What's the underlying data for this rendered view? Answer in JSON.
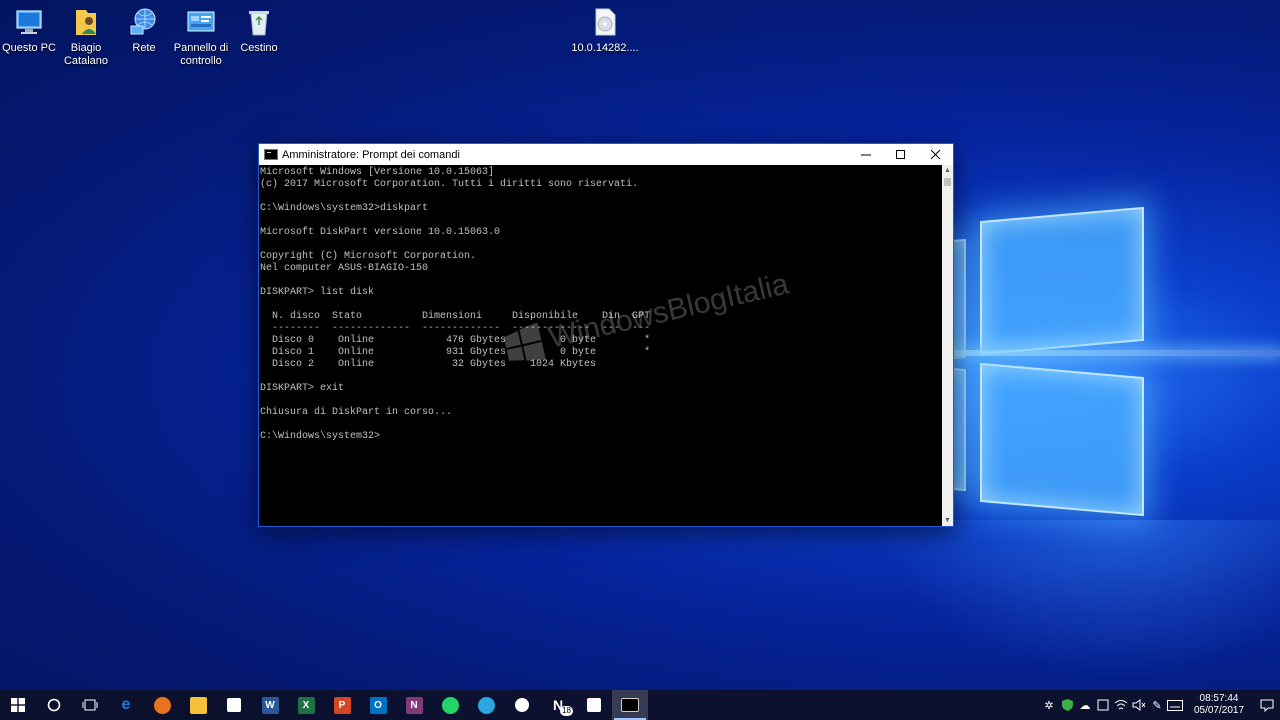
{
  "desktop": {
    "icons": [
      {
        "label": "Questo PC",
        "icon": "computer-icon"
      },
      {
        "label": "Biagio Catalano",
        "icon": "user-folder-icon"
      },
      {
        "label": "Rete",
        "icon": "network-icon"
      },
      {
        "label": "Pannello di controllo",
        "icon": "control-panel-icon"
      },
      {
        "label": "Cestino",
        "icon": "recycle-bin-icon"
      },
      {
        "label": "10.0.14282....",
        "icon": "disc-image-icon"
      }
    ]
  },
  "cmd_window": {
    "title": "Amministratore: Prompt dei comandi",
    "console_lines": [
      "Microsoft Windows [Versione 10.0.15063]",
      "(c) 2017 Microsoft Corporation. Tutti i diritti sono riservati.",
      "",
      "C:\\Windows\\system32>diskpart",
      "",
      "Microsoft DiskPart versione 10.0.15063.0",
      "",
      "Copyright (C) Microsoft Corporation.",
      "Nel computer ASUS-BIAGIO-150",
      "",
      "DISKPART> list disk",
      "",
      "  N. disco  Stato          Dimensioni     Disponibile    Din  GPT",
      "  --------  -------------  -------------  -------------  ---  ---",
      "  Disco 0    Online            476 Gbytes         0 byte        *",
      "  Disco 1    Online            931 Gbytes         0 byte        *",
      "  Disco 2    Online             32 Gbytes    1024 Kbytes",
      "",
      "DISKPART> exit",
      "",
      "Chiusura di DiskPart in corso...",
      "",
      "C:\\Windows\\system32>"
    ]
  },
  "watermark": "WindowsBlogItalia",
  "taskbar": {
    "apps": [
      {
        "name": "edge",
        "letter": "e",
        "color": "#1e7ce0"
      },
      {
        "name": "firefox",
        "letter": "",
        "color": "#e8731e"
      },
      {
        "name": "file-explorer",
        "letter": "",
        "color": "#f3c13a"
      },
      {
        "name": "store",
        "letter": "",
        "color": "#ffffff"
      },
      {
        "name": "word",
        "letter": "W",
        "color": "#2b5797"
      },
      {
        "name": "excel",
        "letter": "X",
        "color": "#1e7145"
      },
      {
        "name": "powerpoint",
        "letter": "P",
        "color": "#d24726"
      },
      {
        "name": "outlook",
        "letter": "O",
        "color": "#0072c6"
      },
      {
        "name": "onenote",
        "letter": "N",
        "color": "#80397b"
      },
      {
        "name": "whatsapp",
        "letter": "",
        "color": "#25d366"
      },
      {
        "name": "telegram",
        "letter": "",
        "color": "#2ca5e0"
      },
      {
        "name": "slack",
        "letter": "",
        "color": "#ffffff"
      },
      {
        "name": "notifier",
        "letter": "N",
        "color": "#ffffff",
        "badge": "18"
      },
      {
        "name": "windows-blog",
        "letter": "",
        "color": "#ffffff"
      },
      {
        "name": "cmd",
        "letter": "",
        "color": "#000000"
      }
    ],
    "clock": {
      "time": "08:57:44",
      "date": "05/07/2017"
    }
  }
}
